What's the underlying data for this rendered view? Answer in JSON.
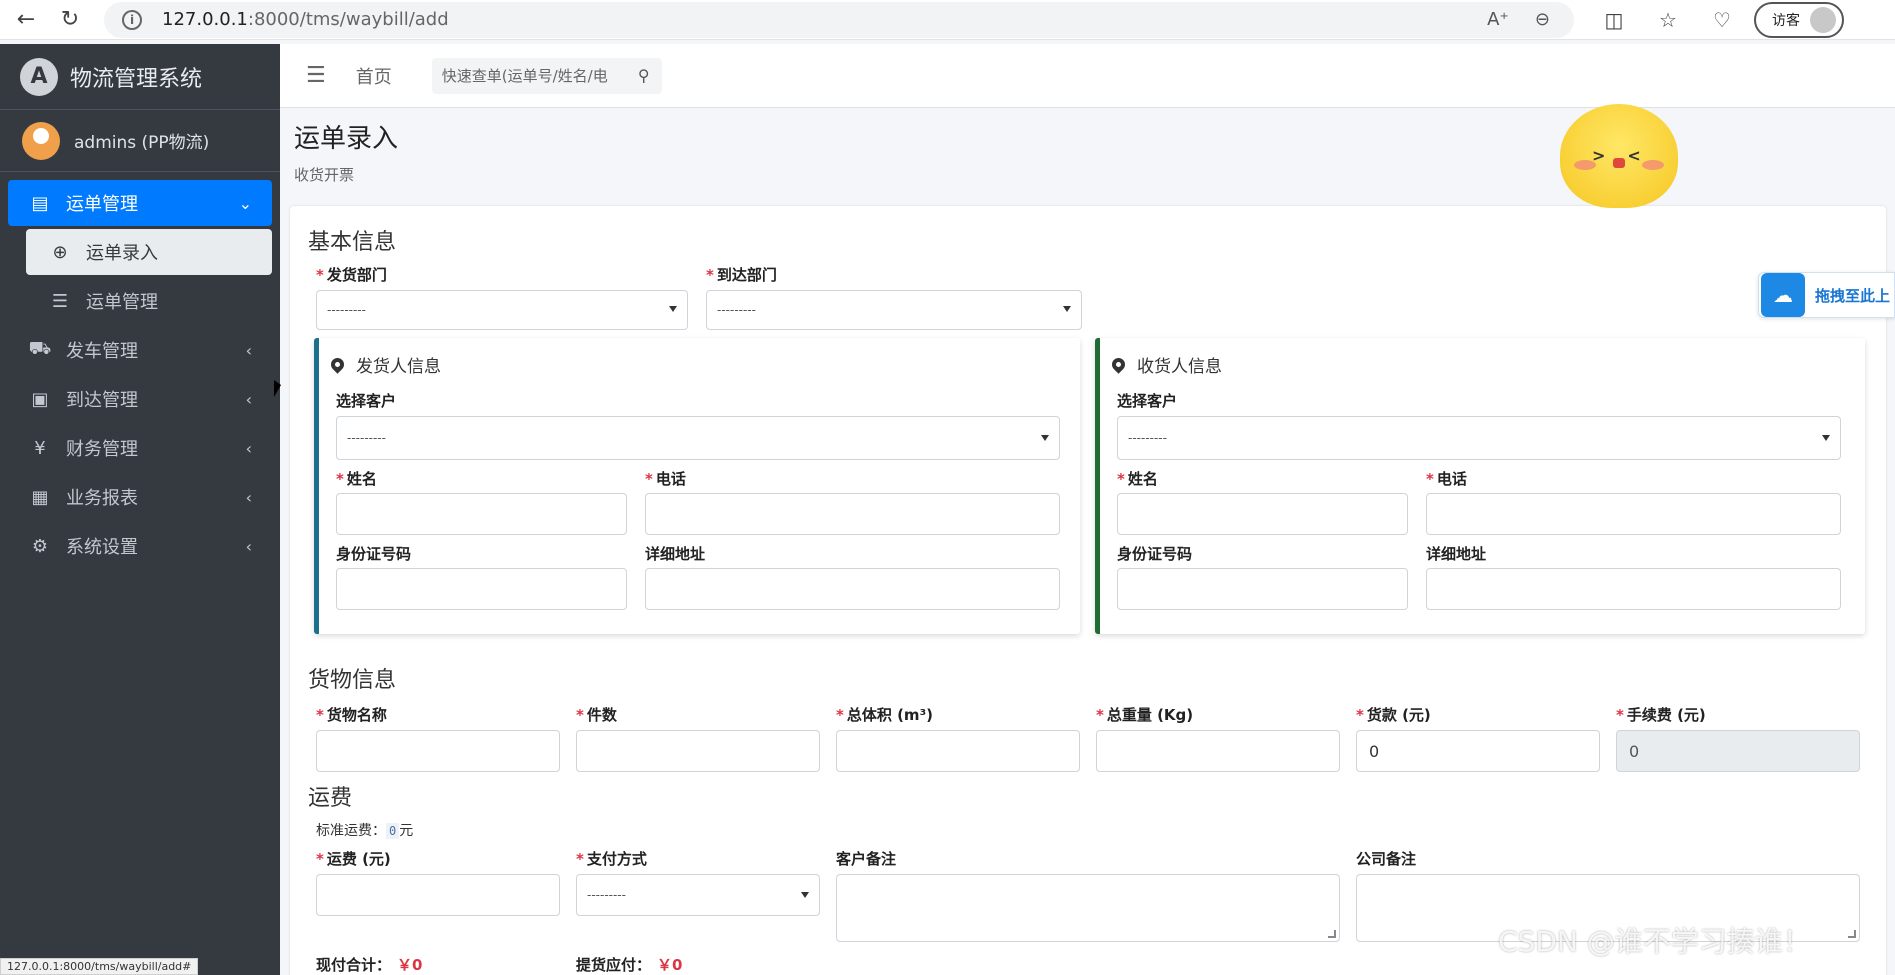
{
  "browser": {
    "url_host": "127.0.0.1",
    "url_path": ":8000/tms/waybill/add",
    "guest_label": "访客",
    "status_url": "127.0.0.1:8000/tms/waybill/add#"
  },
  "sidebar": {
    "brand": "物流管理系统",
    "user": "admins (PP物流)",
    "items": [
      {
        "label": "运单管理",
        "icon": "clipboard-icon",
        "active": true
      },
      {
        "label": "发车管理",
        "icon": "truck-icon"
      },
      {
        "label": "到达管理",
        "icon": "dolly-icon"
      },
      {
        "label": "财务管理",
        "icon": "yen-icon"
      },
      {
        "label": "业务报表",
        "icon": "table-icon"
      },
      {
        "label": "系统设置",
        "icon": "gear-icon"
      }
    ],
    "subitems": [
      {
        "label": "运单录入",
        "icon": "plus-circle-icon",
        "current": true
      },
      {
        "label": "运单管理",
        "icon": "list-icon"
      }
    ]
  },
  "topbar": {
    "home": "首页",
    "search_placeholder": "快速查单(运单号/姓名/电"
  },
  "page": {
    "title": "运单录入",
    "subtitle": "收货开票"
  },
  "basic": {
    "title": "基本信息",
    "from_dept_label": "发货部门",
    "to_dept_label": "到达部门",
    "from_dept_value": "---------",
    "to_dept_value": "---------"
  },
  "sender": {
    "title": "发货人信息",
    "customer_label": "选择客户",
    "customer_value": "---------",
    "name_label": "姓名",
    "phone_label": "电话",
    "id_label": "身份证号码",
    "address_label": "详细地址"
  },
  "receiver": {
    "title": "收货人信息",
    "customer_label": "选择客户",
    "customer_value": "---------",
    "name_label": "姓名",
    "phone_label": "电话",
    "id_label": "身份证号码",
    "address_label": "详细地址"
  },
  "goods": {
    "title": "货物信息",
    "name_label": "货物名称",
    "count_label": "件数",
    "volume_label": "总体积 (m³)",
    "weight_label": "总重量 (Kg)",
    "payment_label": "货款 (元)",
    "fee_label": "手续费 (元)",
    "payment_value": "0",
    "fee_value": "0"
  },
  "freight": {
    "title": "运费",
    "std_label": "标准运费：",
    "std_value": "0",
    "std_unit": "元",
    "fee_label": "运费 (元)",
    "pay_method_label": "支付方式",
    "pay_method_value": "---------",
    "customer_note_label": "客户备注",
    "company_note_label": "公司备注",
    "cash_total_label": "现付合计：",
    "cash_total_value": "￥0",
    "pickup_label": "提货应付：",
    "pickup_value": "￥0"
  },
  "widgets": {
    "drag_label": "拖拽至此上",
    "watermark": "CSDN @谁不学习揍谁！"
  }
}
